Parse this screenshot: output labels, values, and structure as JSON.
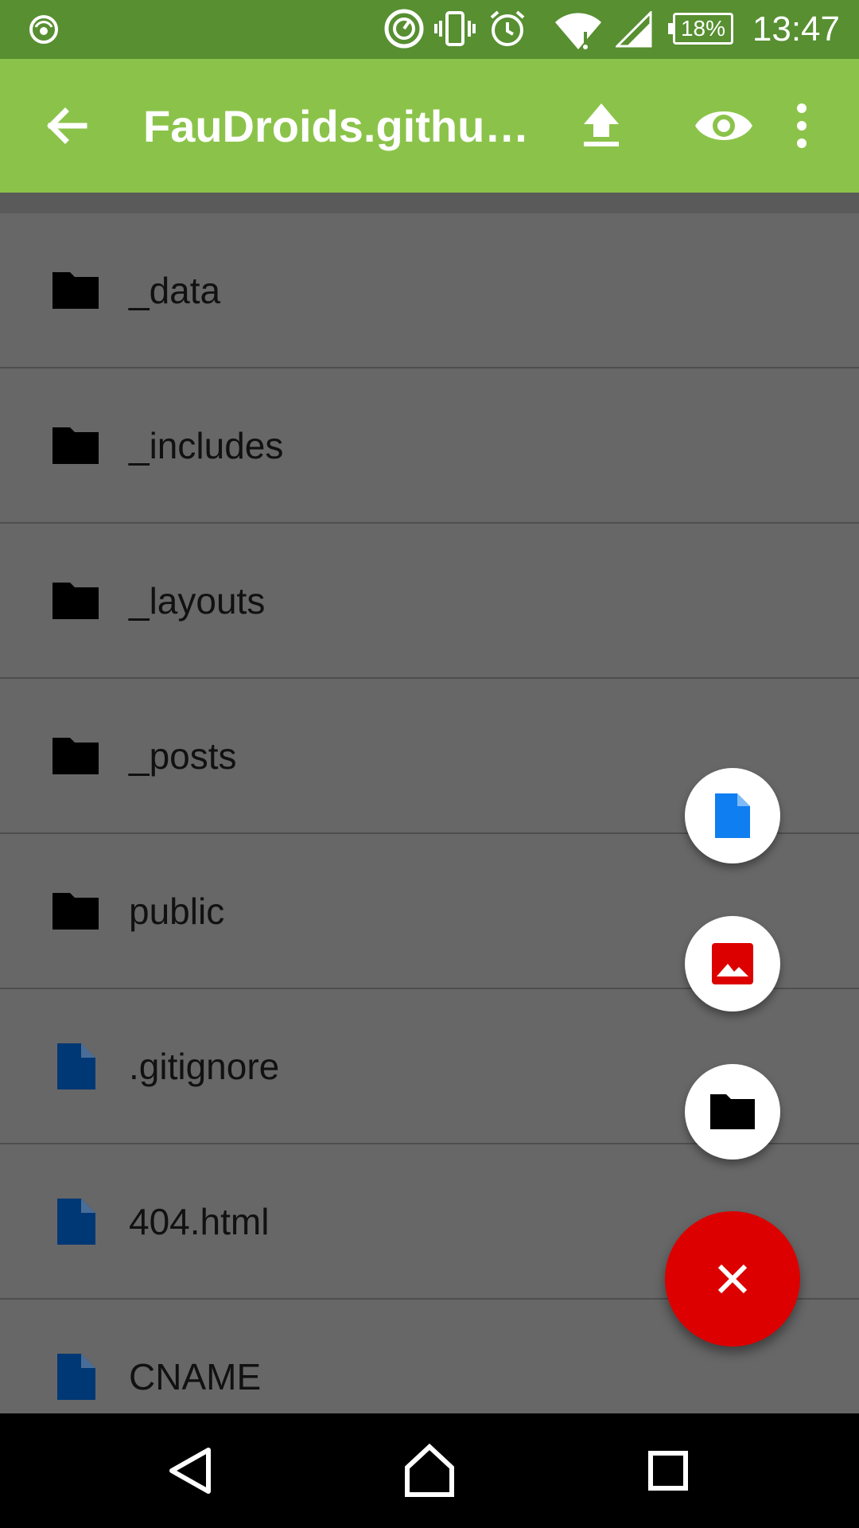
{
  "status_bar": {
    "time": "13:47",
    "battery": "18%",
    "icons": [
      "speedometer-icon",
      "data-saver-icon",
      "vibrate-icon",
      "alarm-icon",
      "wifi-icon",
      "signal-icon",
      "battery-icon"
    ]
  },
  "app_bar": {
    "title": "FauDroids.githu…",
    "color": "#8bc34a",
    "actions": [
      "back-arrow-icon",
      "upload-icon",
      "preview-eye-icon",
      "overflow-menu-icon"
    ]
  },
  "files": [
    {
      "name": "_data",
      "type": "folder"
    },
    {
      "name": "_includes",
      "type": "folder"
    },
    {
      "name": "_layouts",
      "type": "folder"
    },
    {
      "name": "_posts",
      "type": "folder"
    },
    {
      "name": "public",
      "type": "folder"
    },
    {
      "name": ".gitignore",
      "type": "file"
    },
    {
      "name": "404.html",
      "type": "file"
    },
    {
      "name": "CNAME",
      "type": "file"
    }
  ],
  "fab_menu": {
    "items": [
      "new-file-icon",
      "new-image-icon",
      "new-folder-icon"
    ],
    "close": "close-icon",
    "accent": "#dd0000"
  },
  "nav_bar": [
    "back-triangle-icon",
    "home-icon",
    "recents-square-icon"
  ]
}
